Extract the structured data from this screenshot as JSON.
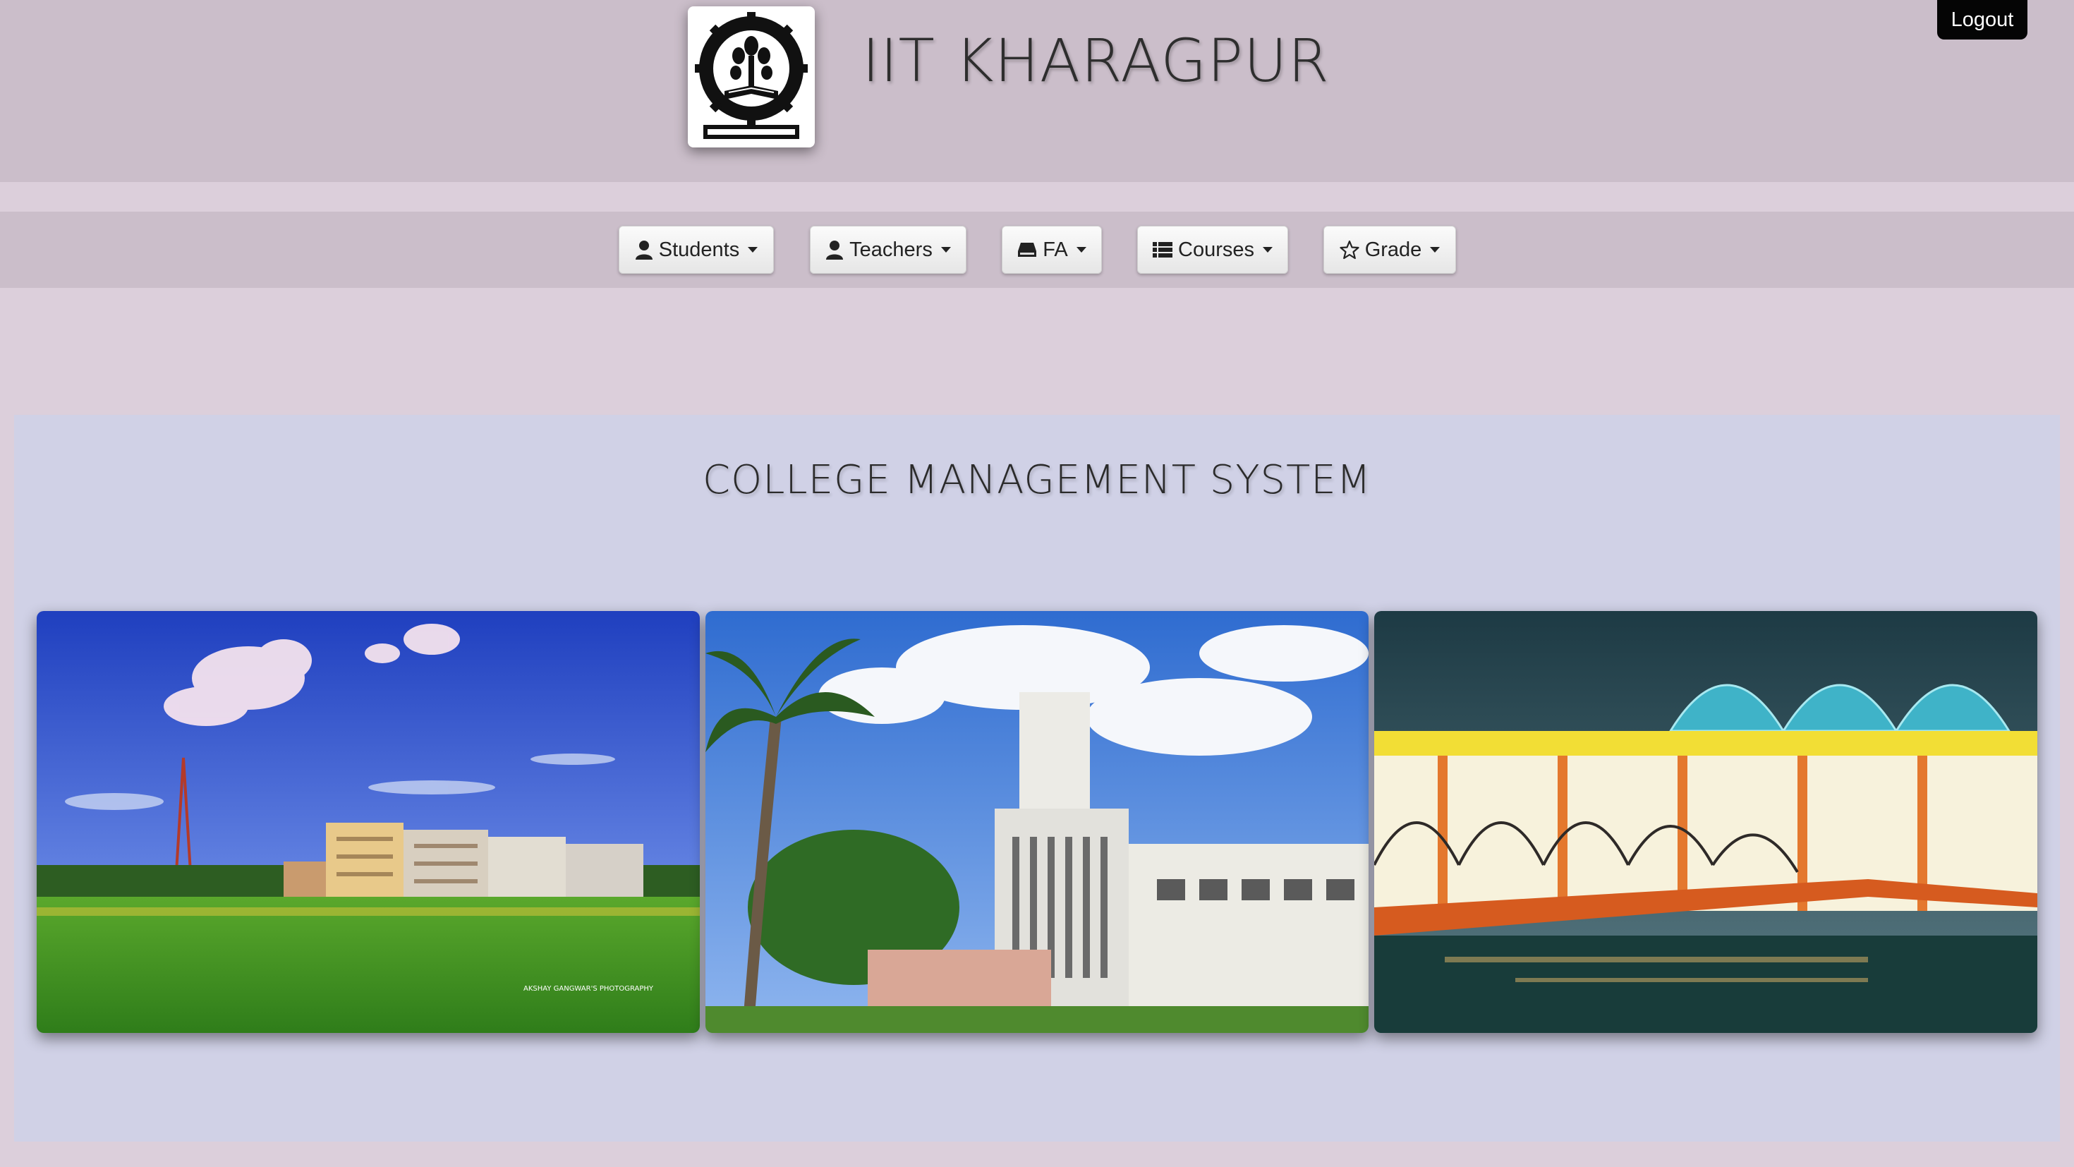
{
  "header": {
    "title": "IIT KHARAGPUR",
    "logo_icon": "iit-kharagpur-emblem",
    "logout_label": "Logout"
  },
  "nav": {
    "items": [
      {
        "label": "Students",
        "icon": "user-icon"
      },
      {
        "label": "Teachers",
        "icon": "user-icon"
      },
      {
        "label": "FA",
        "icon": "hdd-icon"
      },
      {
        "label": "Courses",
        "icon": "list-icon"
      },
      {
        "label": "Grade",
        "icon": "star-outline-icon"
      }
    ]
  },
  "main": {
    "heading": "COLLEGE MANAGEMENT SYSTEM",
    "photos": [
      {
        "name": "campus-field-photo",
        "watermark": "AKSHAY GANGWAR'S PHOTOGRAPHY"
      },
      {
        "name": "main-building-photo"
      },
      {
        "name": "bridge-night-photo"
      }
    ]
  },
  "colors": {
    "header_bg": "#cbbeca",
    "page_bg": "#dccfdb",
    "panel_bg": "#d0d1e6",
    "logout_bg": "#050505"
  }
}
